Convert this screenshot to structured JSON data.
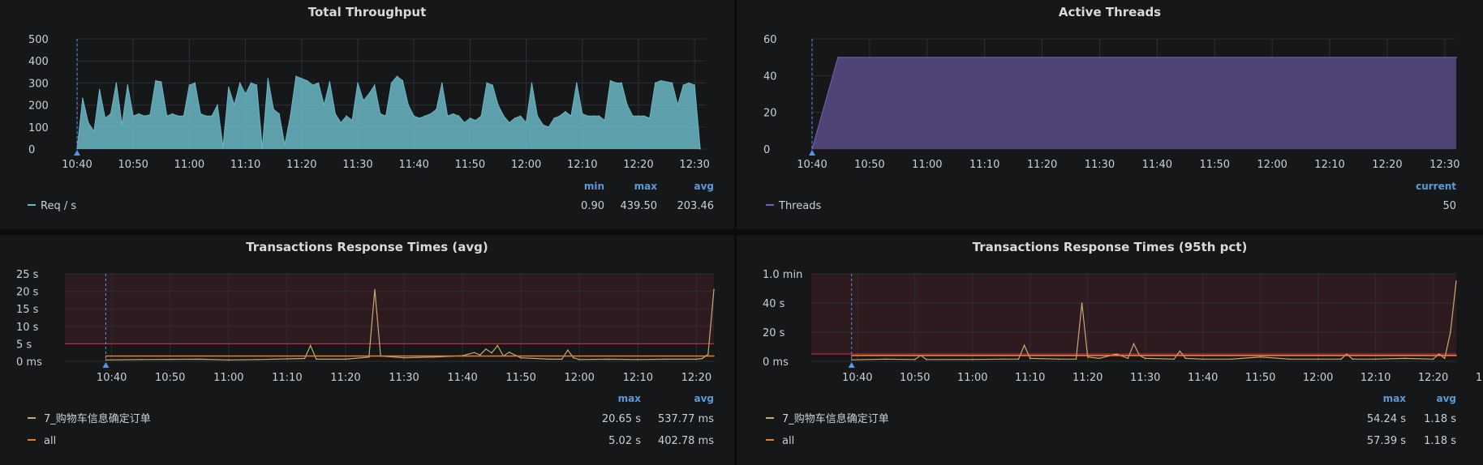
{
  "colors": {
    "panel_bg": "#161719",
    "grid": "#2c2f34",
    "throughput": "#6ab7c6",
    "threads": "#4f4275",
    "threads_line": "#7562b0",
    "txn_line": "#c8a975",
    "all_line": "#ea7d2f",
    "threshold_fill": "#2d1b1f",
    "threshold_line": "#e02f44",
    "annotation": "#5794f2"
  },
  "icons": {
    "annotation_marker": "triangle-icon"
  },
  "chart_data": [
    {
      "id": "throughput",
      "type": "area",
      "title": "Total Throughput",
      "yticks": [
        "0",
        "100",
        "200",
        "300",
        "400",
        "500"
      ],
      "ylim": [
        0,
        500
      ],
      "xticks": [
        "10:40",
        "10:50",
        "11:00",
        "11:10",
        "11:20",
        "11:30",
        "11:40",
        "11:50",
        "12:00",
        "12:10",
        "12:20",
        "12:30"
      ],
      "xlim_minutes": [
        40,
        152
      ],
      "annotation_at_minute": 40,
      "grid": true,
      "legend_headers": [
        "min",
        "max",
        "avg"
      ],
      "series": [
        {
          "name": "Req / s",
          "stats": [
            "0.90",
            "439.50",
            "203.46"
          ],
          "x": [
            40,
            41,
            42,
            43,
            44,
            45,
            46,
            47,
            48,
            49,
            50,
            51,
            52,
            53,
            54,
            55,
            56,
            57,
            58,
            59,
            60,
            61,
            62,
            63,
            64,
            65,
            66,
            67,
            68,
            69,
            70,
            71,
            72,
            73,
            74,
            75,
            76,
            77,
            78,
            79,
            80,
            81,
            82,
            83,
            84,
            85,
            86,
            87,
            88,
            89,
            90,
            91,
            92,
            93,
            94,
            95,
            96,
            97,
            98,
            99,
            100,
            101,
            102,
            103,
            104,
            105,
            106,
            107,
            108,
            109,
            110,
            111,
            112,
            113,
            114,
            115,
            116,
            117,
            118,
            119,
            120,
            121,
            122,
            123,
            124,
            125,
            126,
            127,
            128,
            129,
            130,
            131,
            132,
            133,
            134,
            135,
            136,
            137,
            138,
            139,
            140,
            141,
            142,
            143,
            144,
            145,
            146,
            147,
            148,
            149,
            150,
            151
          ],
          "values": [
            1,
            230,
            120,
            80,
            270,
            140,
            160,
            300,
            110,
            290,
            150,
            160,
            150,
            155,
            310,
            305,
            150,
            160,
            150,
            150,
            290,
            300,
            160,
            150,
            150,
            200,
            10,
            280,
            200,
            300,
            250,
            300,
            290,
            5,
            320,
            180,
            160,
            20,
            150,
            330,
            320,
            310,
            290,
            300,
            200,
            305,
            160,
            120,
            150,
            130,
            300,
            220,
            250,
            290,
            160,
            150,
            300,
            330,
            310,
            200,
            150,
            140,
            150,
            160,
            180,
            300,
            150,
            160,
            150,
            120,
            140,
            130,
            150,
            300,
            290,
            200,
            150,
            120,
            140,
            150,
            120,
            300,
            150,
            110,
            100,
            140,
            150,
            170,
            150,
            300,
            160,
            150,
            150,
            150,
            130,
            310,
            300,
            300,
            200,
            150,
            150,
            150,
            140,
            300,
            310,
            305,
            300,
            200,
            290,
            300,
            290,
            1
          ]
        }
      ]
    },
    {
      "id": "threads",
      "type": "area",
      "title": "Active Threads",
      "yticks": [
        "0",
        "20",
        "40",
        "60"
      ],
      "ylim": [
        0,
        60
      ],
      "xticks": [
        "10:40",
        "10:50",
        "11:00",
        "11:10",
        "11:20",
        "11:30",
        "11:40",
        "11:50",
        "12:00",
        "12:10",
        "12:20",
        "12:30"
      ],
      "xlim_minutes": [
        40,
        152
      ],
      "annotation_at_minute": 40,
      "grid": true,
      "legend_headers": [
        "current"
      ],
      "series": [
        {
          "name": "Threads",
          "stats": [
            "50"
          ],
          "x": [
            40,
            44.5,
            152
          ],
          "values": [
            0,
            50,
            50
          ]
        }
      ]
    },
    {
      "id": "rt_avg",
      "type": "line",
      "title": "Transactions Response Times (avg)",
      "yticks": [
        "0 ms",
        "5 s",
        "10 s",
        "15 s",
        "20 s",
        "25 s"
      ],
      "ylim": [
        0,
        25
      ],
      "threshold": 5,
      "xticks": [
        "10:40",
        "10:50",
        "11:00",
        "11:10",
        "11:20",
        "11:30",
        "11:40",
        "11:50",
        "12:00",
        "12:10",
        "12:20",
        "12:30"
      ],
      "xlim_minutes": [
        32,
        143
      ],
      "annotation_at_minute": 39,
      "grid": true,
      "legend_headers": [
        "max",
        "avg"
      ],
      "series": [
        {
          "name": "7_购物车信息确定订单",
          "stats": [
            "20.65 s",
            "537.77 ms"
          ],
          "x": [
            39,
            45,
            55,
            60,
            65,
            70,
            73,
            74,
            75,
            80,
            84,
            85,
            86,
            90,
            95,
            100,
            102,
            103,
            104,
            105,
            106,
            107,
            108,
            110,
            115,
            117,
            118,
            119,
            120,
            125,
            130,
            135,
            140,
            141,
            142,
            143
          ],
          "values": [
            0.4,
            0.5,
            0.6,
            0.4,
            0.5,
            0.7,
            0.8,
            4.5,
            0.6,
            0.6,
            1.2,
            20.5,
            1.5,
            1.0,
            1.2,
            1.6,
            2.5,
            1.8,
            3.5,
            2.4,
            4.5,
            1.5,
            2.6,
            1.0,
            0.6,
            0.6,
            3.2,
            1.0,
            0.5,
            0.6,
            0.5,
            0.6,
            0.6,
            0.8,
            2.0,
            20.5
          ]
        },
        {
          "name": "all",
          "stats": [
            "5.02 s",
            "402.78 ms"
          ],
          "x": [
            39,
            143
          ],
          "values": [
            1.5,
            1.5
          ]
        }
      ]
    },
    {
      "id": "rt_p95",
      "type": "line",
      "title": "Transactions Response Times (95th pct)",
      "yticks": [
        "0 ms",
        "20 s",
        "40 s",
        "1.0 min"
      ],
      "ylim": [
        0,
        60
      ],
      "threshold": 5,
      "xticks": [
        "10:40",
        "10:50",
        "11:00",
        "11:10",
        "11:20",
        "11:30",
        "11:40",
        "11:50",
        "12:00",
        "12:10",
        "12:20",
        "12:30"
      ],
      "xlim_minutes": [
        32,
        144
      ],
      "annotation_at_minute": 39,
      "grid": true,
      "legend_headers": [
        "max",
        "avg"
      ],
      "series": [
        {
          "name": "7_购物车信息确定订单",
          "stats": [
            "54.24 s",
            "1.18 s"
          ],
          "x": [
            39,
            45,
            50,
            51,
            52,
            60,
            65,
            68,
            69,
            70,
            75,
            78,
            79,
            80,
            82,
            85,
            87,
            88,
            89,
            90,
            95,
            96,
            97,
            100,
            105,
            110,
            115,
            120,
            124,
            125,
            126,
            130,
            135,
            140,
            141,
            142,
            143,
            144
          ],
          "values": [
            1,
            1.5,
            1.2,
            4,
            1.2,
            1.3,
            1.5,
            1.5,
            11,
            2,
            1.5,
            1.5,
            40,
            3,
            2,
            5,
            2,
            12,
            4,
            2,
            1.5,
            7,
            2,
            1.5,
            1.5,
            3,
            1.5,
            1.5,
            1.5,
            5,
            1.5,
            1.5,
            2,
            1.5,
            5,
            2,
            20,
            55
          ]
        },
        {
          "name": "all",
          "stats": [
            "57.39 s",
            "1.18 s"
          ],
          "x": [
            39,
            144
          ],
          "values": [
            4,
            4
          ]
        }
      ]
    }
  ]
}
